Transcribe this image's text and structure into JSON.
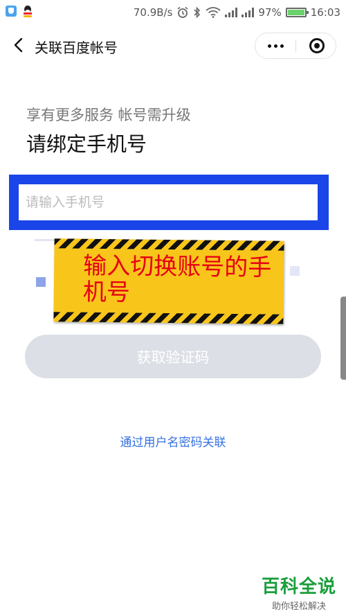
{
  "status_bar": {
    "network_speed": "70.9B/s",
    "battery_percent": "97%",
    "time": "16:03",
    "icons": [
      "app-shield-icon",
      "qq-penguin-icon",
      "alarm-icon",
      "bluetooth-icon",
      "wifi-icon",
      "signal-icon",
      "signal-icon",
      "battery-icon"
    ]
  },
  "header": {
    "title": "关联百度帐号",
    "back_icon": "chevron-left-icon",
    "more_icon": "more-dots-icon",
    "close_icon": "target-close-icon"
  },
  "main": {
    "subtitle": "享有更多服务 帐号需升级",
    "heading": "请绑定手机号",
    "phone_input": {
      "placeholder": "请输入手机号",
      "value": ""
    },
    "get_code_button": "获取验证码",
    "alt_link": "通过用户名密码关联"
  },
  "annotation": {
    "text": "输入切换账号的手机号",
    "highlight_color": "#1a45e8",
    "note_color": "#f8c51b",
    "text_color": "#e60012"
  },
  "watermark": {
    "main": "百科全说",
    "sub": "助你轻松解决"
  }
}
